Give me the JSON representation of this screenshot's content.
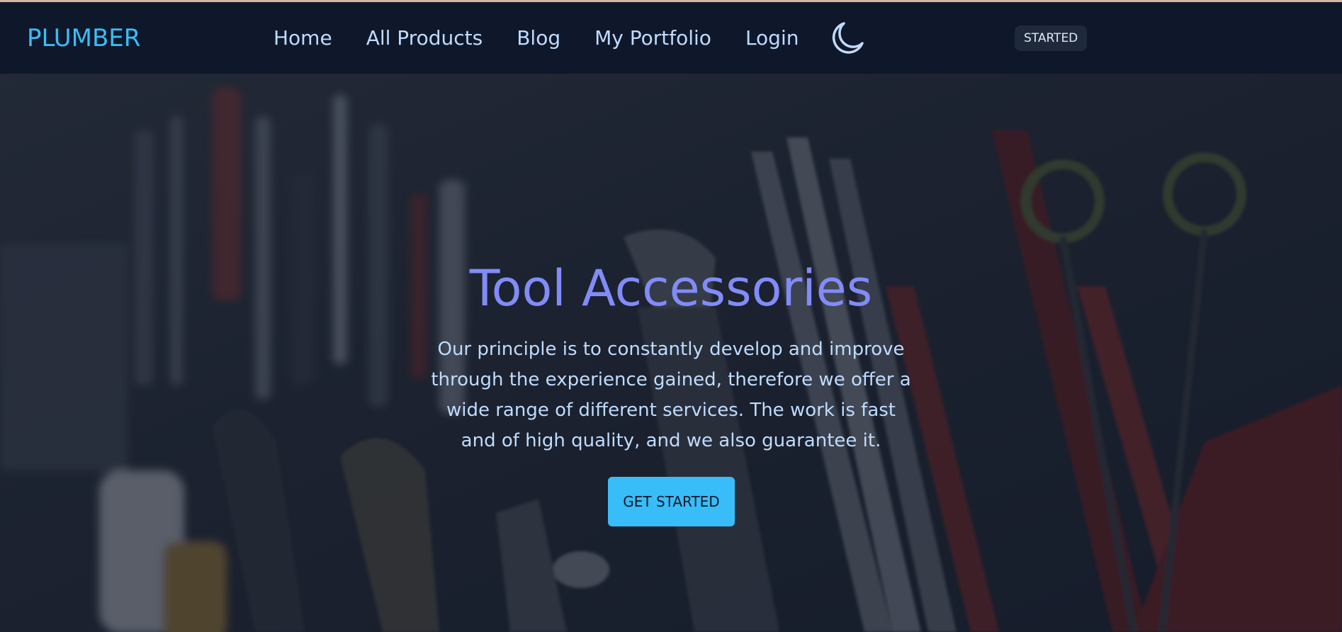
{
  "navbar": {
    "brand": "PLUMBER",
    "links": [
      "Home",
      "All Products",
      "Blog",
      "My Portfolio",
      "Login"
    ],
    "theme_toggle_icon": "moon-icon",
    "badge": "STARTED"
  },
  "hero": {
    "title": "Tool Accessories",
    "text": "Our principle is to constantly develop and improve through the experience gained, therefore we offer a wide range of different services. The work is fast and of high quality, and we also guarantee it.",
    "cta_label": "GET STARTED",
    "background": "dark photo of hand tools (pliers, wrenches, scissors)"
  },
  "colors": {
    "navbar_bg": "#0f172a",
    "brand": "#38bdf8",
    "nav_link": "#bfdbfe",
    "hero_title": "#818cf8",
    "hero_text": "#bfdbfe",
    "cta_bg": "#38bdf8",
    "cta_text": "#0f172a"
  }
}
